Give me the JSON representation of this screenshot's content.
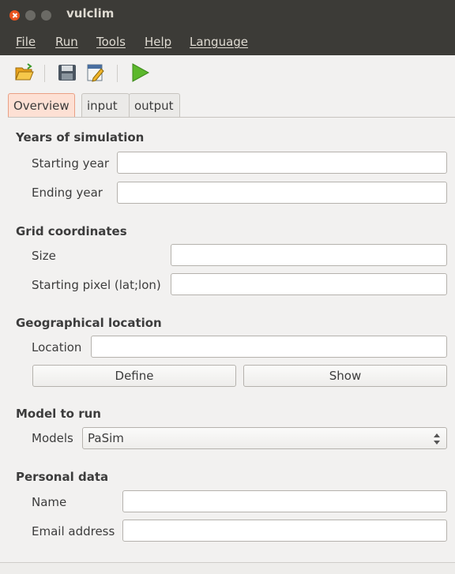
{
  "window": {
    "title": "vulclim"
  },
  "menu": {
    "items": [
      "File",
      "Run",
      "Tools",
      "Help",
      "Language"
    ]
  },
  "toolbar": {
    "icons": [
      "open-folder-icon",
      "save-icon",
      "edit-icon",
      "run-play-icon"
    ]
  },
  "tabs": [
    "Overview",
    "input",
    "output"
  ],
  "sections": {
    "years": {
      "title": "Years of simulation",
      "starting_label": "Starting year",
      "starting_value": "",
      "ending_label": "Ending year",
      "ending_value": ""
    },
    "grid": {
      "title": "Grid coordinates",
      "size_label": "Size",
      "size_value": "",
      "pixel_label": "Starting pixel (lat;lon)",
      "pixel_value": ""
    },
    "geo": {
      "title": "Geographical location",
      "location_label": "Location",
      "location_value": "",
      "define_label": "Define",
      "show_label": "Show"
    },
    "model": {
      "title": "Model to run",
      "models_label": "Models",
      "models_value": "PaSim"
    },
    "personal": {
      "title": "Personal data",
      "name_label": "Name",
      "name_value": "",
      "email_label": "Email address",
      "email_value": ""
    }
  },
  "colors": {
    "accent": "#e95420",
    "active_tab_bg": "#fde0d4",
    "titlebar_bg": "#3c3b37"
  }
}
